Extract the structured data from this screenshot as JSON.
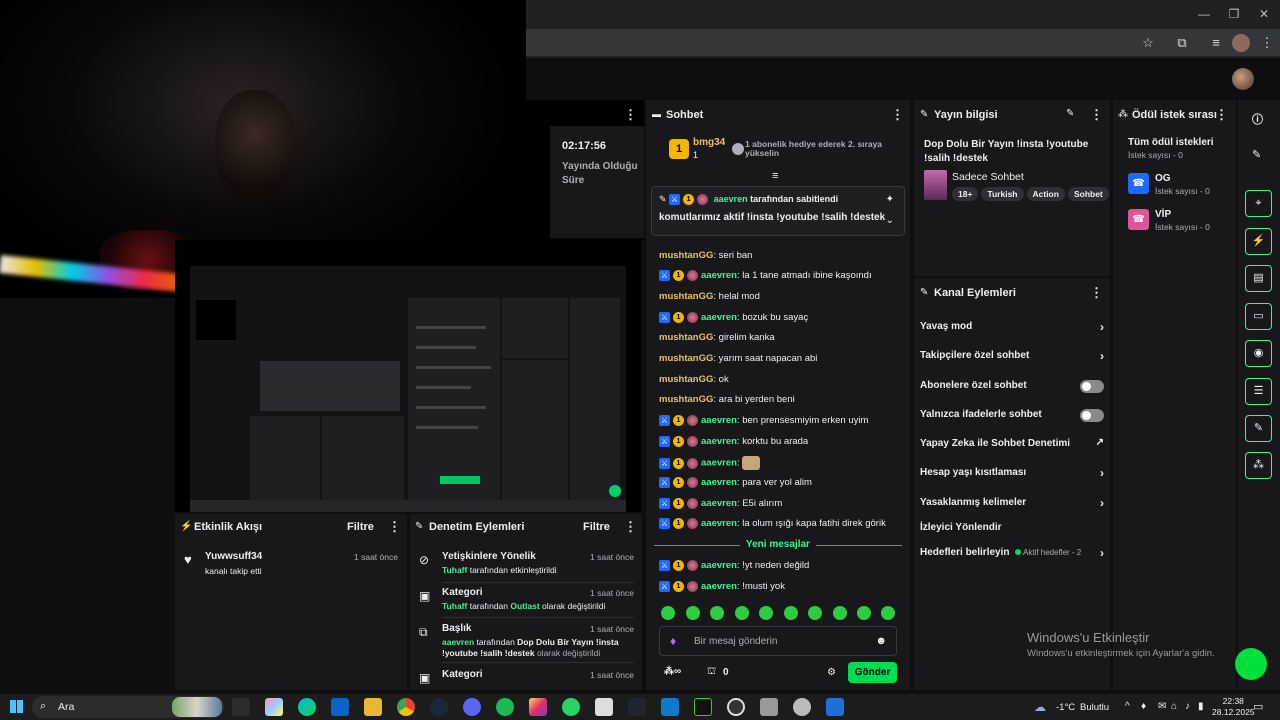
{
  "stats": {
    "time": "02:17:56",
    "time_label": "Yayında Olduğu Süre"
  },
  "chat": {
    "title": "Sohbet",
    "top_user": "bmg34",
    "top_user_count": "1",
    "top_notice": "1 abonelik hediye ederek 2. sıraya yükselin",
    "pinned_by": "aaevren",
    "pinned_suffix": "tarafından sabitlendi",
    "pinned_text": "komutlarımız aktif !insta !youtube !salih !destek",
    "new_messages": "Yeni mesajlar",
    "input_placeholder": "Bir mesaj gönderin",
    "points": "0",
    "send_label": "Gönder",
    "messages": [
      {
        "user": "mushtanGG",
        "text": "seri ban",
        "type": "gold"
      },
      {
        "user": "aaevren",
        "text": "la 1 tane atmadı ibine kaşoındı",
        "type": "green"
      },
      {
        "user": "mushtanGG",
        "text": "helal mod",
        "type": "gold"
      },
      {
        "user": "aaevren",
        "text": "bozuk bu sayaç",
        "type": "green"
      },
      {
        "user": "mushtanGG",
        "text": "girelim kanka",
        "type": "gold"
      },
      {
        "user": "mushtanGG",
        "text": "yarım saat napacan abi",
        "type": "gold"
      },
      {
        "user": "mushtanGG",
        "text": "ok",
        "type": "gold"
      },
      {
        "user": "mushtanGG",
        "text": "ara bi yerden beni",
        "type": "gold"
      },
      {
        "user": "aaevren",
        "text": "ben prensesmiyim erken uyim",
        "type": "green"
      },
      {
        "user": "aaevren",
        "text": "korktu bu arada",
        "type": "green"
      },
      {
        "user": "aaevren",
        "text": "",
        "type": "green-emote"
      },
      {
        "user": "aaevren",
        "text": "para ver yol alim",
        "type": "green"
      },
      {
        "user": "aaevren",
        "text": "E5i alırım",
        "type": "green"
      },
      {
        "user": "aaevren",
        "text": "la olum ışığı kapa fatihi direk görik",
        "type": "green"
      },
      {
        "user": "aaevren",
        "text": "!yt neden değild",
        "type": "green"
      },
      {
        "user": "aaevren",
        "text": "!musti yok",
        "type": "green"
      }
    ]
  },
  "info": {
    "title": "Yayın bilgisi",
    "stream_title": "Dop Dolu Bir Yayın !insta !youtube !salih !destek",
    "category": "Sadece Sohbet",
    "tags": [
      "18+",
      "Turkish",
      "Action",
      "Sohbet"
    ]
  },
  "actions": {
    "title": "Kanal Eylemleri",
    "items": [
      {
        "label": "Yavaş mod"
      },
      {
        "label": "Takipçilere özel sohbet"
      },
      {
        "label": "Abonelere özel sohbet"
      },
      {
        "label": "Yalnızca ifadelerle sohbet"
      },
      {
        "label": "Yapay Zeka ile Sohbet Denetimi"
      },
      {
        "label": "Hesap yaşı kısıtlaması"
      },
      {
        "label": "Yasaklanmış kelimeler"
      },
      {
        "label": "İzleyici Yönlendir"
      },
      {
        "label": "Hedefleri belirleyin"
      }
    ],
    "goals_status": "Aktif hedefler - 2"
  },
  "rewards": {
    "title": "Ödül istek sırası",
    "all_title": "Tüm ödül istekleri",
    "all_count": "İstek sayısı - 0",
    "items": [
      {
        "label": "OG",
        "count": "İstek sayısı - 0",
        "color": "#1f69ff"
      },
      {
        "label": "VİP",
        "count": "İstek sayısı - 0",
        "color": "#e0559a"
      }
    ]
  },
  "activity": {
    "title": "Etkinlik Akışı",
    "filter": "Filtre",
    "user": "Yuwwsuff34",
    "time": "1 saat önce",
    "desc": "kanalı takip etti"
  },
  "moderation": {
    "title": "Denetim Eylemleri",
    "filter": "Filtre",
    "items": [
      {
        "title": "Yetişkinlere Yönelik",
        "time": "1 saat önce",
        "actor": "Tuhaff",
        "desc": "tarafından etkinleştirildi",
        "icon": "eye-off-icon"
      },
      {
        "title": "Kategori",
        "time": "1 saat önce",
        "actor": "Tuhaff",
        "desc_mid": "tarafından",
        "value": "Outlast",
        "desc": "olarak değiştirildi",
        "icon": "category-icon"
      },
      {
        "title": "Başlık",
        "time": "1 saat önce",
        "actor": "aaevren",
        "desc_mid": "tarafından",
        "value": "Dop Dolu Bir Yayın !insta !youtube !salih !destek",
        "desc": "olarak değiştirildi",
        "icon": "title-icon"
      },
      {
        "title": "Kategori",
        "time": "1 saat önce",
        "icon": "category-icon"
      }
    ]
  },
  "taskbar": {
    "search": "Ara",
    "weather": "-1°C",
    "weather_label": "Bulutlu",
    "time": "22:38",
    "date": "28.12.2025"
  },
  "windows_activate": {
    "title": "Windows'u Etkinleştir",
    "subtitle": "Windows'u etkinleştirmek için Ayarlar'a gidin."
  },
  "colors": {
    "accent_green": "#00dd55",
    "gold": "#e8c16a",
    "user_green": "#3ff38f",
    "panel": "#18181b"
  }
}
